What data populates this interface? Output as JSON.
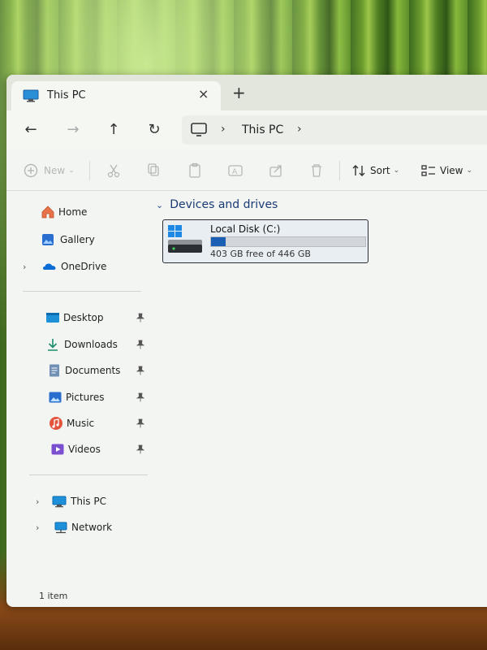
{
  "tab": {
    "title": "This PC",
    "close": "×",
    "new": "+"
  },
  "nav": {
    "back": "←",
    "forward": "→",
    "up": "↑",
    "refresh": "↻"
  },
  "address": {
    "sep1": "›",
    "location": "This PC",
    "sep2": "›"
  },
  "toolbar": {
    "new_label": "New",
    "sort_label": "Sort",
    "view_label": "View"
  },
  "sidebar": {
    "top": [
      {
        "label": "Home",
        "icon": "home-icon"
      },
      {
        "label": "Gallery",
        "icon": "gallery-icon"
      },
      {
        "label": "OneDrive",
        "icon": "onedrive-icon"
      }
    ],
    "pinned": [
      {
        "label": "Desktop",
        "icon": "desktop-icon"
      },
      {
        "label": "Downloads",
        "icon": "downloads-icon"
      },
      {
        "label": "Documents",
        "icon": "documents-icon"
      },
      {
        "label": "Pictures",
        "icon": "pictures-icon"
      },
      {
        "label": "Music",
        "icon": "music-icon"
      },
      {
        "label": "Videos",
        "icon": "videos-icon"
      }
    ],
    "bottom": [
      {
        "label": "This PC",
        "icon": "this-pc-icon"
      },
      {
        "label": "Network",
        "icon": "network-icon"
      }
    ]
  },
  "main": {
    "section_title": "Devices and drives",
    "drive": {
      "name": "Local Disk (C:)",
      "free_text": "403 GB free of 446 GB",
      "used_fraction": 0.096
    }
  },
  "status": {
    "items": "1 item"
  },
  "colors": {
    "accent": "#1a5fb4",
    "window_bg": "#f3f5f2"
  }
}
